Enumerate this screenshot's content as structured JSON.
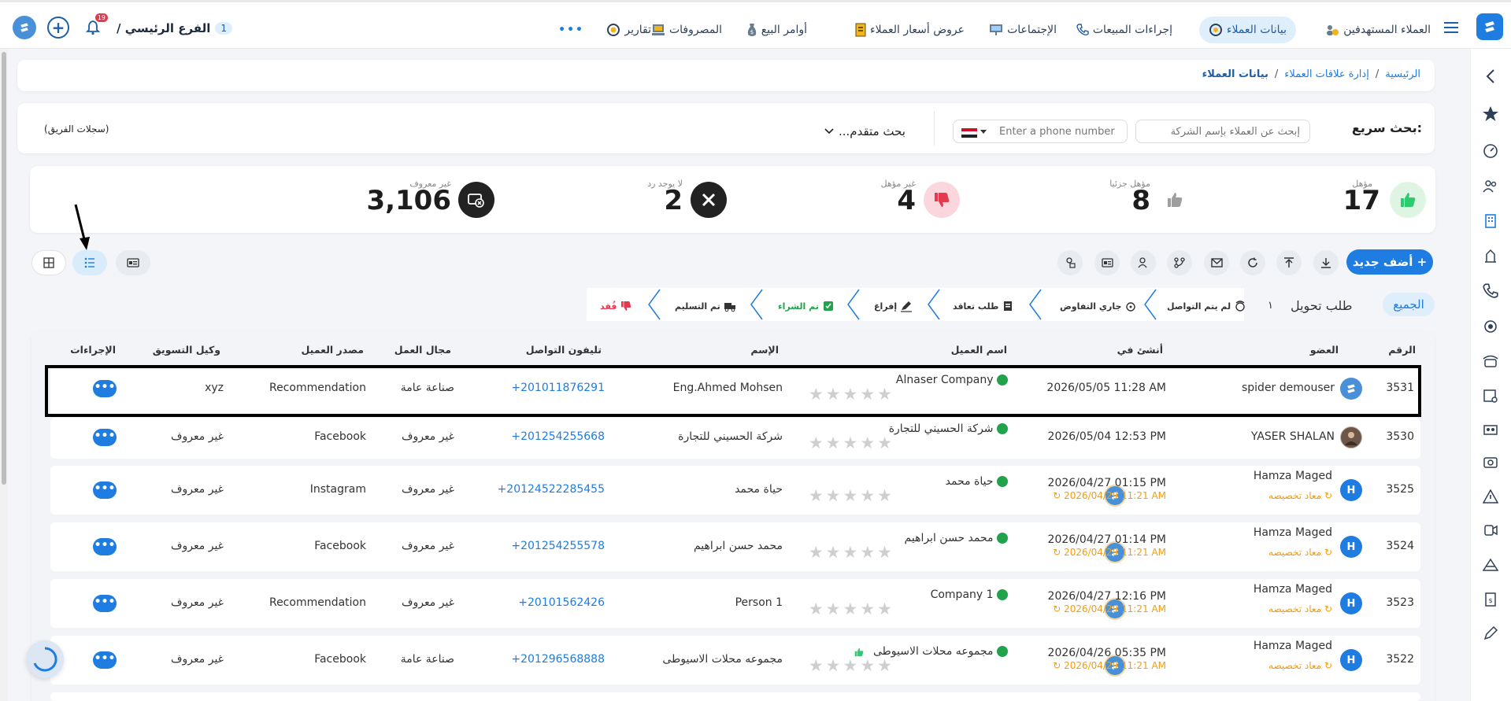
{
  "topbar": {
    "branch_count": "1",
    "branch_label": "الفرع الرئيسي /",
    "notif_count": "19",
    "nav": [
      {
        "label": "العملاء المستهدفين",
        "icon": "target-customers-icon"
      },
      {
        "label": "بيانات العملاء",
        "icon": "customer-data-icon"
      },
      {
        "label": "إجراءات المبيعات",
        "icon": "phone-icon"
      },
      {
        "label": "الإجتماعات",
        "icon": "meeting-icon"
      },
      {
        "label": "عروض أسعار العملاء",
        "icon": "quote-icon"
      },
      {
        "label": "أوامر البيع",
        "icon": "sales-order-icon"
      },
      {
        "label": "المصروفات",
        "icon": "expenses-icon"
      },
      {
        "label": "تقارير",
        "icon": "reports-icon"
      }
    ],
    "more_label": "•••"
  },
  "breadcrumb": {
    "home": "الرئيسية",
    "sep1": "/",
    "crm": "إدارة علاقات العملاء",
    "sep2": "/",
    "current": "بيانات العملاء"
  },
  "search": {
    "label": "بحث سريع:",
    "company_placeholder": "إبحث عن العملاء بإسم الشركة",
    "phone_placeholder": "Enter a phone number",
    "advanced_label": "بحث متقدم...",
    "team_records": "(سجلات الفريق)"
  },
  "stats": [
    {
      "label": "مؤهل",
      "value": "17",
      "color": "#2ecc71",
      "icon": "thumbs-up-icon"
    },
    {
      "label": "مؤهل جزئيا",
      "value": "8",
      "color": "#9e9e9e",
      "icon": "thumbs-up-gray-icon"
    },
    {
      "label": "غير مؤهل",
      "value": "4",
      "color": "#e53950",
      "icon": "thumbs-down-icon"
    },
    {
      "label": "لا يوجد رد",
      "value": "2",
      "color": "#222222",
      "icon": "close-circle-icon"
    },
    {
      "label": "غير معروف",
      "value": "3,106",
      "color": "#222222",
      "icon": "unknown-icon"
    }
  ],
  "toolbar": {
    "add_new_label": "+ أضف جديد"
  },
  "stages": {
    "all_label": "الجميع",
    "transfer_label": "طلب تحويل",
    "transfer_count": "١",
    "items": [
      {
        "label": "لم يتم التواصل",
        "icon": "no-contact-icon"
      },
      {
        "label": "جاري التفاوض",
        "icon": "negotiation-icon"
      },
      {
        "label": "طلب تعاقد",
        "icon": "contract-request-icon"
      },
      {
        "label": "إفراغ",
        "icon": "signing-icon"
      },
      {
        "label": "تم الشراء",
        "icon": "purchased-icon"
      },
      {
        "label": "تم التسليم",
        "icon": "delivered-icon"
      },
      {
        "label": "فُقد",
        "icon": "lost-icon"
      }
    ]
  },
  "table": {
    "headers": {
      "num": "الرقم",
      "member": "العضو",
      "created": "أنشئ في",
      "client_name": "اسم العميل",
      "name": "الإسم",
      "phone": "تليفون التواصل",
      "field": "مجال العمل",
      "source": "مصدر العميل",
      "agent": "وكيل التسويق",
      "actions": "الإجراءات"
    },
    "rows": [
      {
        "num": "3531",
        "member": "spider demouser",
        "created": "2026/05/05 11:28 AM",
        "reassigned_at": "",
        "reassign_label": "",
        "client": "Alnaser Company",
        "name": "Eng.Ahmed Mohsen",
        "phone": "+201011876291",
        "field": "صناعة عامة",
        "source": "Recommendation",
        "agent": "xyz",
        "avatar": "logo",
        "highlight": true
      },
      {
        "num": "3530",
        "member": "YASER SHALAN",
        "created": "2026/05/04 12:53 PM",
        "reassigned_at": "",
        "reassign_label": "",
        "client": "شركة الحسيني للتجارة",
        "name": "شركة الحسيني للتجارة",
        "phone": "+201254255668",
        "field": "غير معروف",
        "source": "Facebook",
        "agent": "غير معروف",
        "avatar": "photo"
      },
      {
        "num": "3525",
        "member": "Hamza Maged",
        "created": "2026/04/27 01:15 PM",
        "reassigned_at": "2026/04/29 11:21 AM",
        "reassign_label": "معاد تخصيصه",
        "client": "حياة محمد",
        "name": "حياة محمد",
        "phone": "+20124522285455",
        "field": "غير معروف",
        "source": "Instagram",
        "agent": "غير معروف",
        "avatar": "H"
      },
      {
        "num": "3524",
        "member": "Hamza Maged",
        "created": "2026/04/27 01:14 PM",
        "reassigned_at": "2026/04/29 11:21 AM",
        "reassign_label": "معاد تخصيصه",
        "client": "محمد حسن ابراهيم",
        "name": "محمد حسن ابراهيم",
        "phone": "+201254255578",
        "field": "غير معروف",
        "source": "Facebook",
        "agent": "غير معروف",
        "avatar": "H"
      },
      {
        "num": "3523",
        "member": "Hamza Maged",
        "created": "2026/04/27 12:16 PM",
        "reassigned_at": "2026/04/29 11:21 AM",
        "reassign_label": "معاد تخصيصه",
        "client": "Company 1",
        "name": "Person 1",
        "phone": "+20101562426",
        "field": "غير معروف",
        "source": "Recommendation",
        "agent": "غير معروف",
        "avatar": "H"
      },
      {
        "num": "3522",
        "member": "Hamza Maged",
        "created": "2026/04/26 05:35 PM",
        "reassigned_at": "2026/04/29 11:21 AM",
        "reassign_label": "معاد تخصيصه",
        "client": "مجموعه محلات الاسيوطى",
        "name": "مجموعه محلات الاسيوطى",
        "phone": "+201296568888",
        "field": "صناعة عامة",
        "source": "Facebook",
        "agent": "غير معروف",
        "avatar": "H"
      }
    ],
    "actions_label": "•••",
    "stars": "★★★★★"
  },
  "colors": {
    "brand": "#1f7ce0",
    "accent_light": "#dfeefb",
    "reassign": "#f39c12",
    "online": "#22a24c"
  }
}
